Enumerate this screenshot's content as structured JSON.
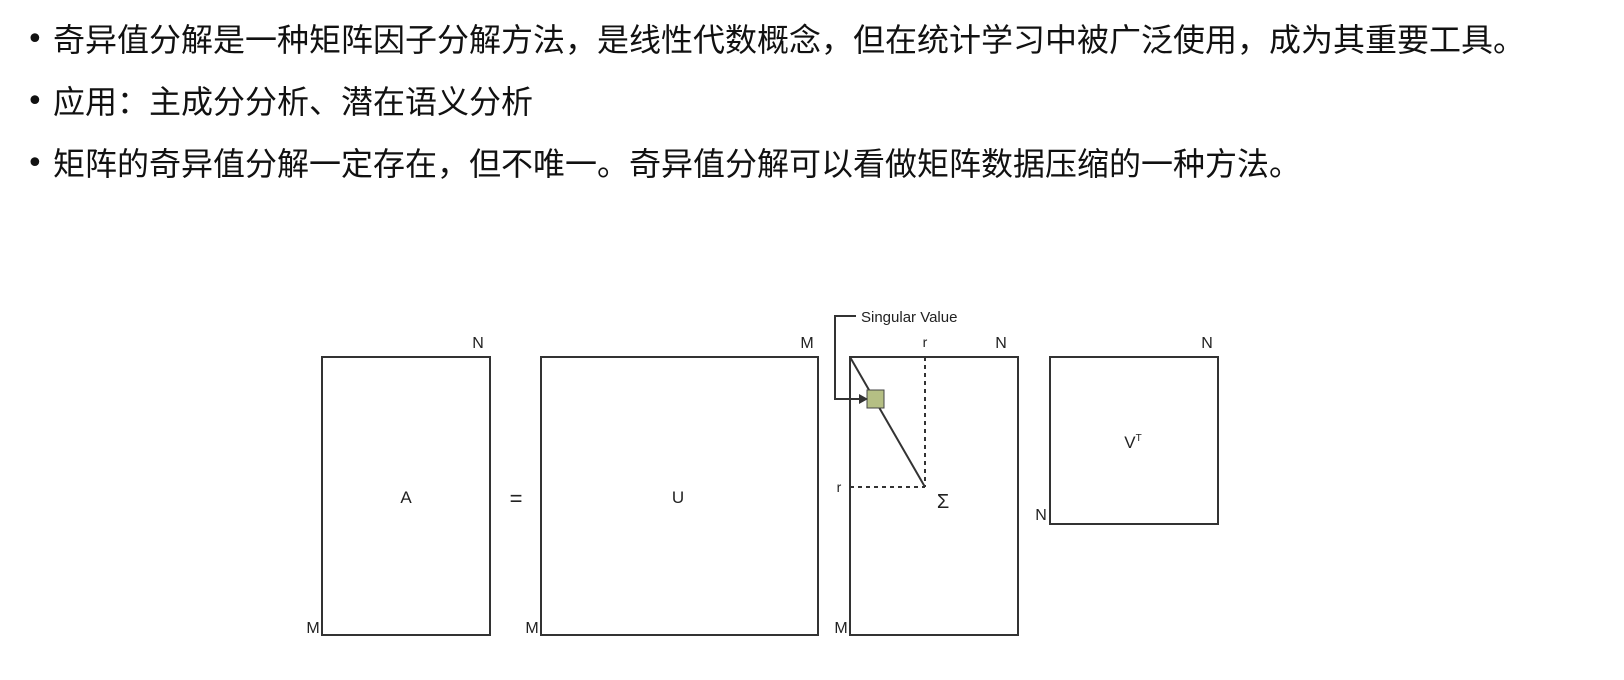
{
  "bullets": [
    "奇异值分解是一种矩阵因子分解方法，是线性代数概念，但在统计学习中被广泛使用，成为其重要工具。",
    "应用：主成分分析、潜在语义分析",
    "矩阵的奇异值分解一定存在，但不唯一。奇异值分解可以看做矩阵数据压缩的一种方法。"
  ],
  "bullet_symbol": "•",
  "diagram": {
    "matrix_a": {
      "label": "A",
      "top_label": "N",
      "side_label": "M"
    },
    "equals": "=",
    "matrix_u": {
      "label": "U",
      "top_label": "M",
      "side_label": "M"
    },
    "matrix_sigma": {
      "label": "Σ",
      "top_label": "N",
      "side_label": "M",
      "rank_top": "r",
      "rank_side": "r"
    },
    "matrix_vt": {
      "label": "V",
      "label_sup": "T",
      "top_label": "N",
      "side_label": "N"
    },
    "singular_value_label": "Singular Value",
    "singular_value_color": "#b5bf84"
  }
}
